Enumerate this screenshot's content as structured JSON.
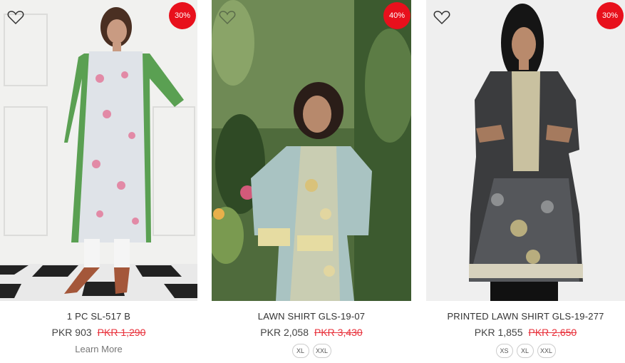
{
  "products": [
    {
      "name": "1 PC SL-517 B",
      "price": "PKR 903",
      "old_price": "PKR 1,290",
      "discount": "30%",
      "action": "Learn More",
      "sizes": []
    },
    {
      "name": "LAWN SHIRT GLS-19-07",
      "price": "PKR 2,058",
      "old_price": "PKR 3,430",
      "discount": "40%",
      "action": "",
      "sizes": [
        "XL",
        "XXL"
      ]
    },
    {
      "name": "PRINTED LAWN SHIRT GLS-19-277",
      "price": "PKR 1,855",
      "old_price": "PKR 2,650",
      "discount": "30%",
      "action": "",
      "sizes": [
        "XS",
        "XL",
        "XXL"
      ]
    }
  ],
  "icons": {
    "wishlist": "heart-outline-icon"
  },
  "colors": {
    "badge": "#e8101c",
    "old_price": "#e8303a",
    "text": "#333333"
  }
}
